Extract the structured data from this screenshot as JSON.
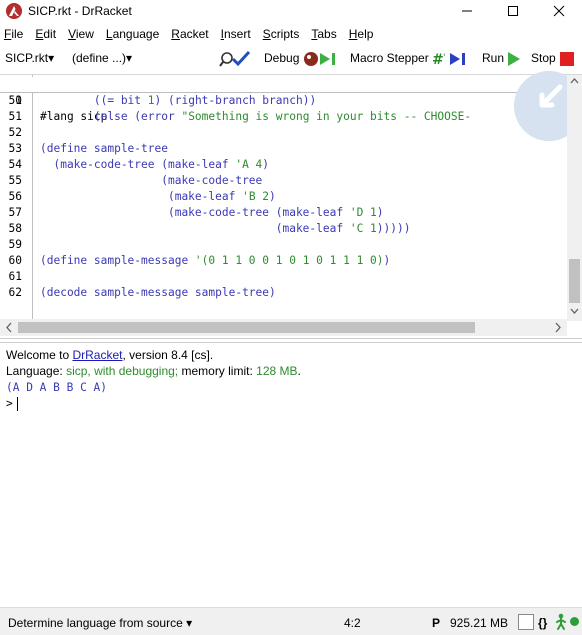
{
  "window": {
    "title": "SICP.rkt - DrRacket"
  },
  "menu": {
    "items": [
      {
        "u": "F",
        "rest": "ile"
      },
      {
        "u": "E",
        "rest": "dit"
      },
      {
        "u": "V",
        "rest": "iew"
      },
      {
        "u": "L",
        "rest": "anguage"
      },
      {
        "u": "R",
        "rest": "acket"
      },
      {
        "u": "I",
        "rest": "nsert"
      },
      {
        "u": "S",
        "rest": "cripts"
      },
      {
        "u": "T",
        "rest": "abs"
      },
      {
        "u": "H",
        "rest": "elp"
      }
    ]
  },
  "toolbar": {
    "file_menu": "SICP.rkt▾",
    "define_menu": "(define ...)▾",
    "debug": "Debug",
    "macro_stepper": "Macro Stepper",
    "run": "Run",
    "stop": "Stop"
  },
  "editor": {
    "first_line": {
      "num": "1",
      "text": "#lang sicp"
    },
    "lines": [
      {
        "num": "50",
        "text": "        ((= bit 1) (right-branch branch))"
      },
      {
        "num": "51",
        "text": "        (else (error \"Something is wrong in your bits -- CHOOSE-"
      },
      {
        "num": "52",
        "text": ""
      },
      {
        "num": "53",
        "text": "(define sample-tree"
      },
      {
        "num": "54",
        "text": "  (make-code-tree (make-leaf 'A 4)"
      },
      {
        "num": "55",
        "text": "                  (make-code-tree"
      },
      {
        "num": "56",
        "text": "                   (make-leaf 'B 2)"
      },
      {
        "num": "57",
        "text": "                   (make-code-tree (make-leaf 'D 1)"
      },
      {
        "num": "58",
        "text": "                                   (make-leaf 'C 1)))))"
      },
      {
        "num": "59",
        "text": ""
      },
      {
        "num": "60",
        "text": "(define sample-message '(0 1 1 0 0 1 0 1 0 1 1 1 0))"
      },
      {
        "num": "61",
        "text": ""
      },
      {
        "num": "62",
        "text": "(decode sample-message sample-tree)"
      }
    ]
  },
  "repl": {
    "welcome_prefix": "Welcome to ",
    "welcome_link": "DrRacket",
    "welcome_suffix": ", version 8.4 [cs].",
    "lang_prefix": "Language: ",
    "lang_name": "sicp, with debugging;",
    "lang_mid": " memory limit: ",
    "lang_mem": "128 MB",
    "lang_end": ".",
    "output": "(A D A B B C A)",
    "prompt": ">"
  },
  "status": {
    "language_selector": "Determine language from source ▾",
    "position": "4:2",
    "p_label": "P",
    "memory": "925.21 MB",
    "parens": "{}"
  },
  "colors": {
    "code_blue": "#3a3ab5",
    "string_green": "#2e8b2e",
    "stop_red": "#e02020",
    "run_green": "#3cb043"
  }
}
